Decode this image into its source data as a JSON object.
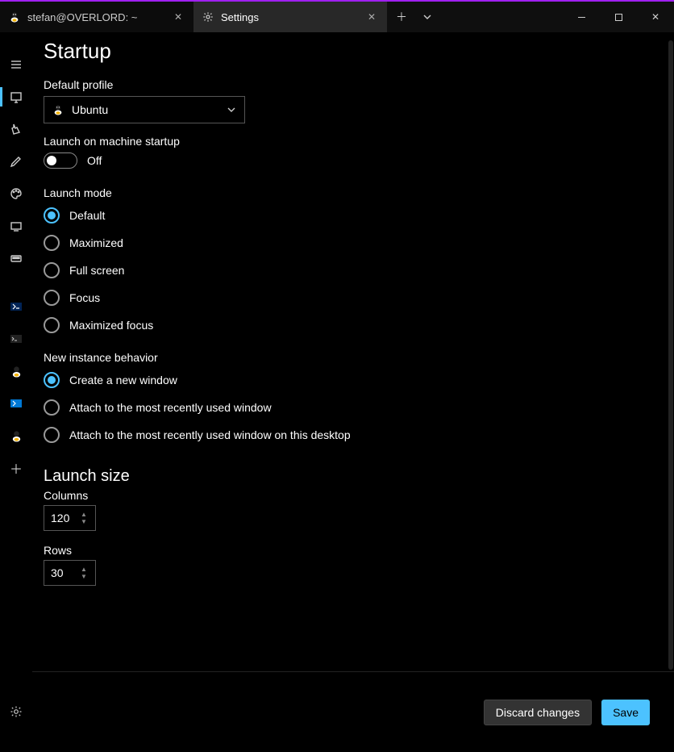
{
  "tabs": [
    {
      "title": "stefan@OVERLORD: ~",
      "icon": "tux"
    },
    {
      "title": "Settings",
      "icon": "gear"
    }
  ],
  "page": {
    "title": "Startup",
    "default_profile_label": "Default profile",
    "default_profile_value": "Ubuntu",
    "launch_startup_label": "Launch on machine startup",
    "launch_startup_state": "Off",
    "launch_mode_label": "Launch mode",
    "launch_modes": [
      "Default",
      "Maximized",
      "Full screen",
      "Focus",
      "Maximized focus"
    ],
    "launch_mode_selected": 0,
    "new_instance_label": "New instance behavior",
    "new_instance_opts": [
      "Create a new window",
      "Attach to the most recently used window",
      "Attach to the most recently used window on this desktop"
    ],
    "new_instance_selected": 0,
    "launch_size_title": "Launch size",
    "columns_label": "Columns",
    "columns_value": "120",
    "rows_label": "Rows",
    "rows_value": "30"
  },
  "footer": {
    "discard": "Discard changes",
    "save": "Save"
  }
}
